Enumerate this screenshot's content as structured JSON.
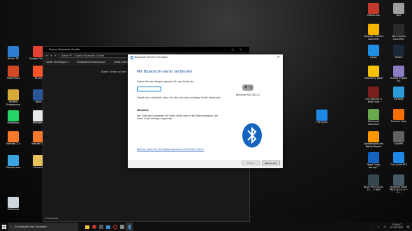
{
  "desktop": {
    "left_icons": [
      {
        "label": "Dieser PC",
        "color": "#2d7dd2"
      },
      {
        "label": "Google Chrome",
        "color": "#e34133"
      },
      {
        "label": "PowerPoint",
        "color": "#d24726"
      },
      {
        "label": "Brave",
        "color": "#fb542b"
      },
      {
        "label": "Andere Programme",
        "color": "#d9a93a"
      },
      {
        "label": "Word",
        "color": "#2b579a"
      },
      {
        "label": "WhatsApp",
        "color": "#25d366"
      },
      {
        "label": "Blender...",
        "color": "#e8e8e8"
      },
      {
        "label": "Blender 2.8",
        "color": "#f5792a"
      },
      {
        "label": "Blender 2...",
        "color": "#f5792a"
      },
      {
        "label": "Dolphin.exe",
        "color": "#3ba3e0"
      },
      {
        "label": "Kinovea",
        "color": "#e8c25a"
      },
      {
        "label": "Mülleimer",
        "color": "#cfd8dc"
      }
    ],
    "right_icons": [
      {
        "label": "PKHeX.exe",
        "color": "#c0392b"
      },
      {
        "label": "Ne0",
        "color": "#9e9e9e"
      },
      {
        "label": "Rockstar Games Launcher",
        "color": "#f4b400"
      },
      {
        "label": "Epic Games Launcher",
        "color": "#2a2a2a"
      },
      {
        "label": "Uplay",
        "color": "#1f8fe5"
      },
      {
        "label": "Steam",
        "color": "#1b2838"
      },
      {
        "label": "Geometry Dash",
        "color": "#f4c20d"
      },
      {
        "label": "Hunter Impact Ed.",
        "color": "#8e7cc3"
      },
      {
        "label": "The Witcher 3 Wild Hunt",
        "color": "#7a1e1e"
      },
      {
        "label": "Fortnite",
        "color": "#2b9cd8"
      },
      {
        "label": "Minecraft Launcher",
        "color": "#6aa84f"
      },
      {
        "label": "Portmei Party",
        "color": "#ff6f00"
      },
      {
        "label": "Bombergrounds Battle Royale",
        "color": "#ff9800"
      },
      {
        "label": "KuroPel",
        "color": "#616161"
      },
      {
        "label": "Team Sonic Racing™",
        "color": "#1565c0"
      },
      {
        "label": "The Cycle PTS",
        "color": "#1e88e5"
      },
      {
        "label": "BLUE PROTOCOL TO ...ア予約",
        "color": "#37474f"
      },
      {
        "label": "[Direct]Y BLUE PROTOCOL ゲーム...",
        "color": "#455a64"
      }
    ],
    "mid_icon": {
      "label": "The Cycle",
      "color": "#1e88e5"
    }
  },
  "explorer": {
    "title": "Eigene Bluetooth-Geräte",
    "address": "Dieser PC  ›  Eigene Bluetooth-Geräte",
    "commands": [
      "Gerät hinzufügen ▾",
      "Bluetooth-Einstellungen",
      "Gerät entfernen"
    ],
    "empty_text": "Dieser Ordner ist leer.",
    "status": "0 Elemente"
  },
  "dialog": {
    "title": "Bluetooth-Gerät hinzufügen",
    "heading": "Mit Bluetooth-Gerät verbinden",
    "instruction": "Geben Sie den Kopplungscode für das Gerät ein.",
    "code_value": "",
    "verify_text": "Damit wird verifiziert, dass Sie sich mit dem richtigen Gerät verbinden.",
    "hint_heading": "Hinweis:",
    "hint_text": "Der Code wird entweder auf Ihrem Gerät oder in der Dokumentation, die Ihrem Gerät beiliegt, angezeigt.",
    "device_name": "Nintendo RVL-CNT-01",
    "link_text": "Was ist, wenn ich den Kopplungscode nicht finden kann?",
    "next_label": "Weiter",
    "cancel_label": "Abbrechen"
  },
  "taskbar": {
    "search_placeholder": "Suchbegriff hier eingeben",
    "time": "23:40:47",
    "date": "01.05.2020"
  }
}
